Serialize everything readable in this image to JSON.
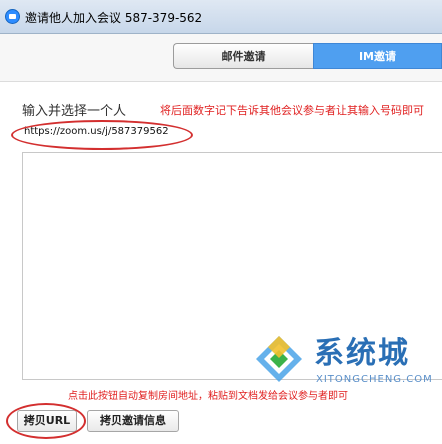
{
  "window": {
    "title": "邀请他人加入会议 587-379-562"
  },
  "tabs": [
    {
      "label": "邮件邀请",
      "active": false
    },
    {
      "label": "IM邀请",
      "active": true
    }
  ],
  "main": {
    "prompt_label": "输入并选择一个人",
    "url": "https://zoom.us/j/587379562"
  },
  "annotations": {
    "top_note": "将后面数字记下告诉其他会议参与者让其输入号码即可",
    "bottom_note": "点击此按钮自动复制房间地址，粘贴到文档发给会议参与者即可"
  },
  "buttons": {
    "copy_url": "拷贝URL",
    "copy_invite_info": "拷贝邀请信息"
  },
  "watermark": {
    "name": "系统城",
    "domain": "XITONGCHENG.COM"
  },
  "colors": {
    "active_tab": "#4f9ff0",
    "annotation_red": "#e02020",
    "title_bar": "#c7d7ea",
    "watermark_blue": "#2a6fb5"
  }
}
